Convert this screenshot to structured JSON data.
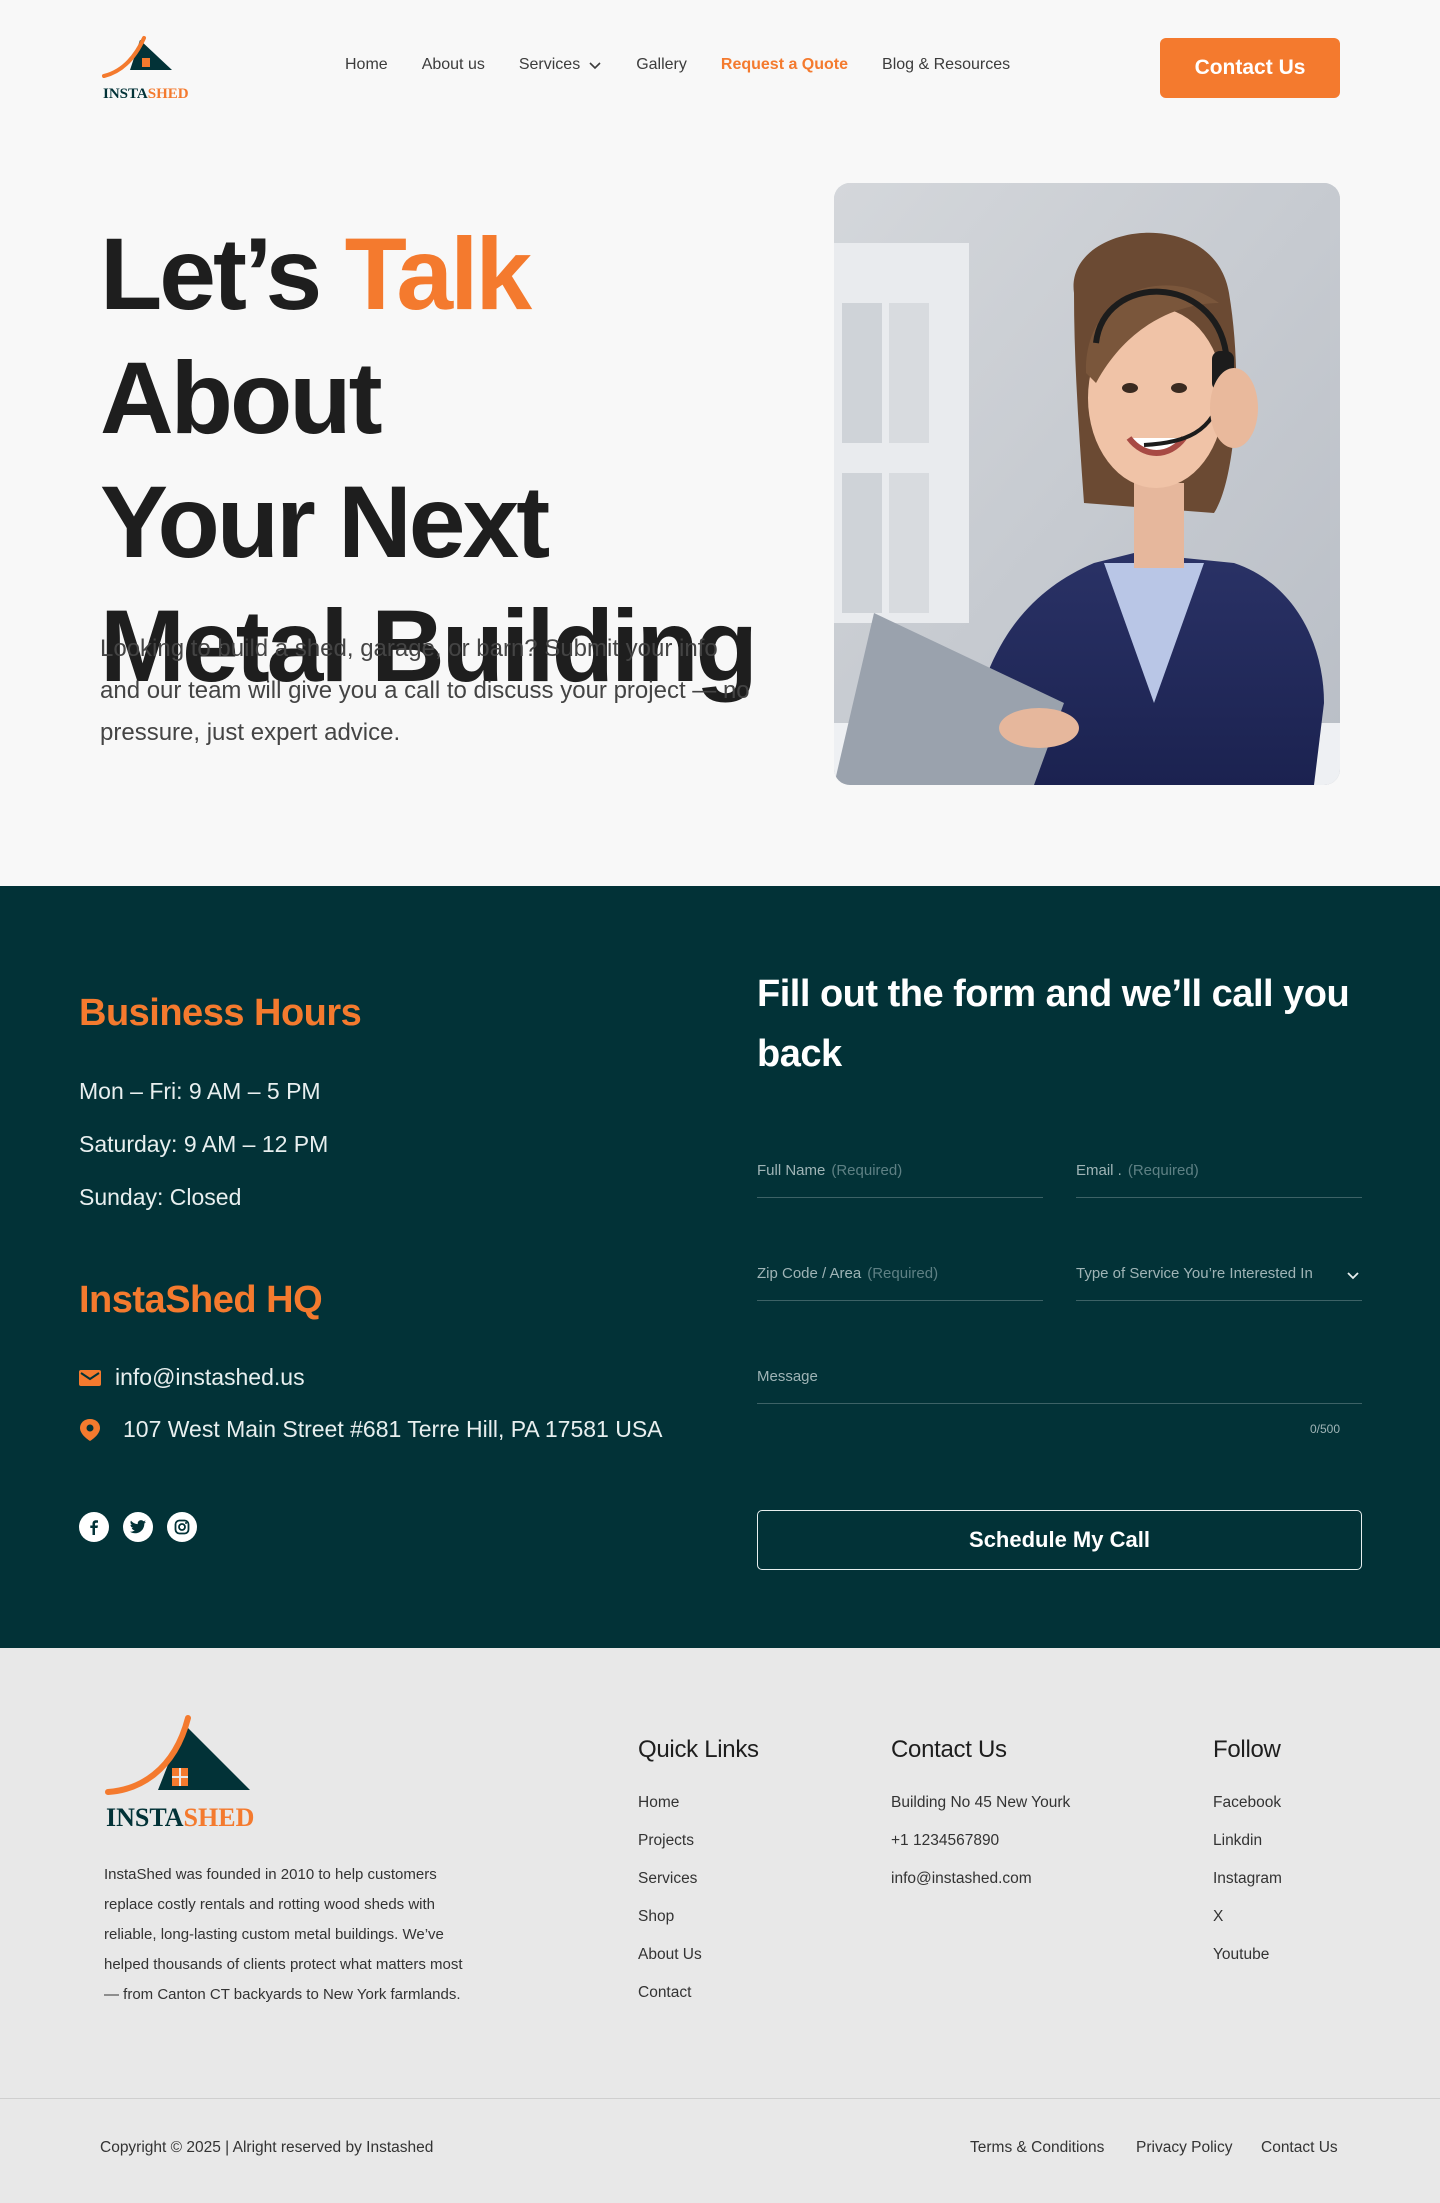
{
  "brand": {
    "logo_text_dark": "INSTA",
    "logo_text_accent": "SHED",
    "accent_color": "#f47a2e",
    "dark_color": "#023237"
  },
  "nav": {
    "items": [
      {
        "label": "Home"
      },
      {
        "label": "About us"
      },
      {
        "label": "Services"
      },
      {
        "label": "Gallery"
      },
      {
        "label": "Request a Quote"
      },
      {
        "label": "Blog & Resources"
      }
    ],
    "contact_button": "Contact Us"
  },
  "hero": {
    "title_line1_a": "Let’s",
    "title_line1_accent": "Talk",
    "title_line1_b": "About",
    "title_line2": "Your Next",
    "title_line3": "Metal Building",
    "description": "Looking to build a shed, garage, or barn? Submit your info and our team will give you a call to discuss your project — no pressure, just expert advice."
  },
  "contact_section": {
    "hours_title": "Business Hours",
    "hours": [
      "Mon – Fri: 9 AM – 5 PM",
      "Saturday: 9 AM – 12 PM",
      "Sunday: Closed"
    ],
    "hq_title": "InstaShed HQ",
    "email": "info@instashed.us",
    "address": "107 West Main Street #681 Terre Hill, PA 17581 USA",
    "socials": [
      "facebook-icon",
      "twitter-icon",
      "instagram-icon"
    ]
  },
  "form": {
    "title": "Fill out the form and we’ll call you back",
    "full_name_label": "Full Name",
    "full_name_hint": "(Required)",
    "email_label": "Email .",
    "email_hint": "(Required)",
    "zip_label": "Zip Code / Area",
    "zip_hint": "(Required)",
    "service_label": "Type of Service You’re Interested In",
    "message_label": "Message",
    "counter": "0/500",
    "submit": "Schedule My Call"
  },
  "footer": {
    "about": "InstaShed was founded in 2010 to help customers replace costly rentals and rotting wood sheds with reliable, long-lasting custom metal buildings. We’ve helped thousands of clients protect what matters most — from Canton CT backyards to New York farmlands.",
    "quick_links_title": "Quick Links",
    "quick_links": [
      "Home",
      "Projects",
      "Services",
      "Shop",
      "About Us",
      "Contact"
    ],
    "contact_title": "Contact Us",
    "contact_items": [
      "Building No 45 New Yourk",
      "+1 1234567890",
      "info@instashed.com"
    ],
    "follow_title": "Follow",
    "follow_items": [
      "Facebook",
      "Linkdin",
      "Instagram",
      "X",
      "Youtube"
    ],
    "copyright": "Copyright © 2025 | Alright reserved by  Instashed",
    "legal": [
      "Terms & Conditions",
      "Privacy Policy",
      "Contact Us"
    ]
  }
}
